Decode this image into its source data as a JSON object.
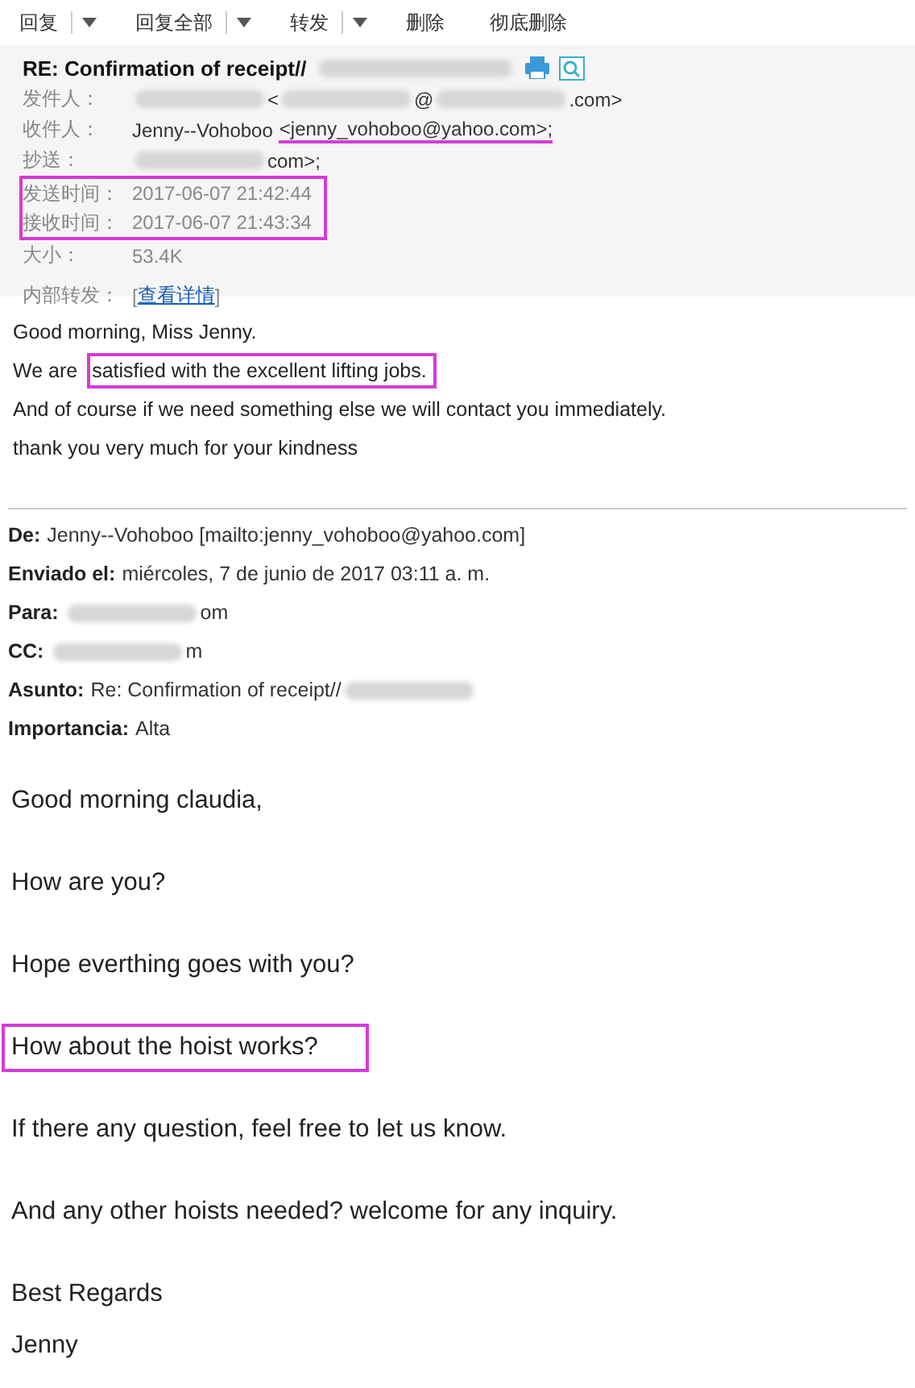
{
  "toolbar": [
    {
      "label": "回复",
      "has_menu": true
    },
    {
      "label": "回复全部",
      "has_menu": true
    },
    {
      "label": "转发",
      "has_menu": true
    },
    {
      "label": "删除",
      "has_menu": false
    },
    {
      "label": "彻底删除",
      "has_menu": false
    }
  ],
  "header": {
    "subject": "RE: Confirmation of receipt//",
    "fields": [
      {
        "label": "发件人：",
        "parts": [
          {
            "kind": "redacted"
          },
          {
            "kind": "text",
            "text": "<"
          },
          {
            "kind": "redacted"
          },
          {
            "kind": "text",
            "text": "@"
          },
          {
            "kind": "redacted"
          },
          {
            "kind": "text",
            "text": ".com>"
          }
        ]
      },
      {
        "label": "收件人：",
        "parts": [
          {
            "kind": "text",
            "text": "Jenny--Vohoboo"
          },
          {
            "kind": "underlined",
            "text": "<jenny_vohoboo@yahoo.com>;"
          }
        ]
      },
      {
        "label": "抄送：",
        "parts": [
          {
            "kind": "redacted"
          },
          {
            "kind": "text",
            "text": "com>;"
          }
        ]
      }
    ],
    "times": {
      "boxed": true,
      "rows": [
        {
          "label": "发送时间：",
          "value": "2017-06-07 21:42:44"
        },
        {
          "label": "接收时间：",
          "value": "2017-06-07 21:43:34"
        }
      ]
    },
    "size": {
      "label": "大小：",
      "value": "53.4K"
    },
    "forward": {
      "label": "内部转发：",
      "open": "[",
      "link": "查看详情",
      "close": "]"
    }
  },
  "body": [
    {
      "parts": [
        {
          "text": "Good morning, Miss Jenny.",
          "boxed": false
        }
      ]
    },
    {
      "parts": [
        {
          "text": "We are ",
          "boxed": false
        },
        {
          "text": "satisfied with the excellent lifting jobs.",
          "boxed": true
        }
      ]
    },
    {
      "parts": [
        {
          "text": "And of course if we need something else we will contact you immediately.",
          "boxed": false
        }
      ]
    },
    {
      "parts": [
        {
          "text": "thank you very much for your kindness",
          "boxed": false
        }
      ]
    }
  ],
  "quoted_header": [
    {
      "label": "De:",
      "parts": [
        {
          "kind": "text",
          "text": "Jenny--Vohoboo [mailto:jenny_vohoboo@yahoo.com]"
        }
      ]
    },
    {
      "label": "Enviado el:",
      "parts": [
        {
          "kind": "text",
          "text": "miércoles, 7 de junio de 2017 03:11 a. m."
        }
      ]
    },
    {
      "label": "Para:",
      "parts": [
        {
          "kind": "redacted"
        },
        {
          "kind": "text",
          "text": "om"
        }
      ]
    },
    {
      "label": "CC:",
      "parts": [
        {
          "kind": "redacted"
        },
        {
          "kind": "text",
          "text": "m"
        }
      ]
    },
    {
      "label": "Asunto:",
      "parts": [
        {
          "kind": "text",
          "text": "Re: Confirmation of receipt//"
        },
        {
          "kind": "redacted"
        }
      ]
    },
    {
      "label": "Importancia:",
      "parts": [
        {
          "kind": "text",
          "text": "Alta"
        }
      ]
    }
  ],
  "quoted_body": [
    {
      "text": "Good morning claudia,",
      "boxed": false
    },
    {
      "text": "How are you?",
      "boxed": false
    },
    {
      "text": "Hope everthing goes with you?",
      "boxed": false
    },
    {
      "text": "How about the hoist works?",
      "boxed": true
    },
    {
      "text": "If there any question, feel free to let us know.",
      "boxed": false
    },
    {
      "text": "And any other hoists needed? welcome for any inquiry.",
      "boxed": false
    },
    {
      "text": "Best Regards",
      "boxed": false
    },
    {
      "text": "Jenny",
      "boxed": false
    }
  ]
}
